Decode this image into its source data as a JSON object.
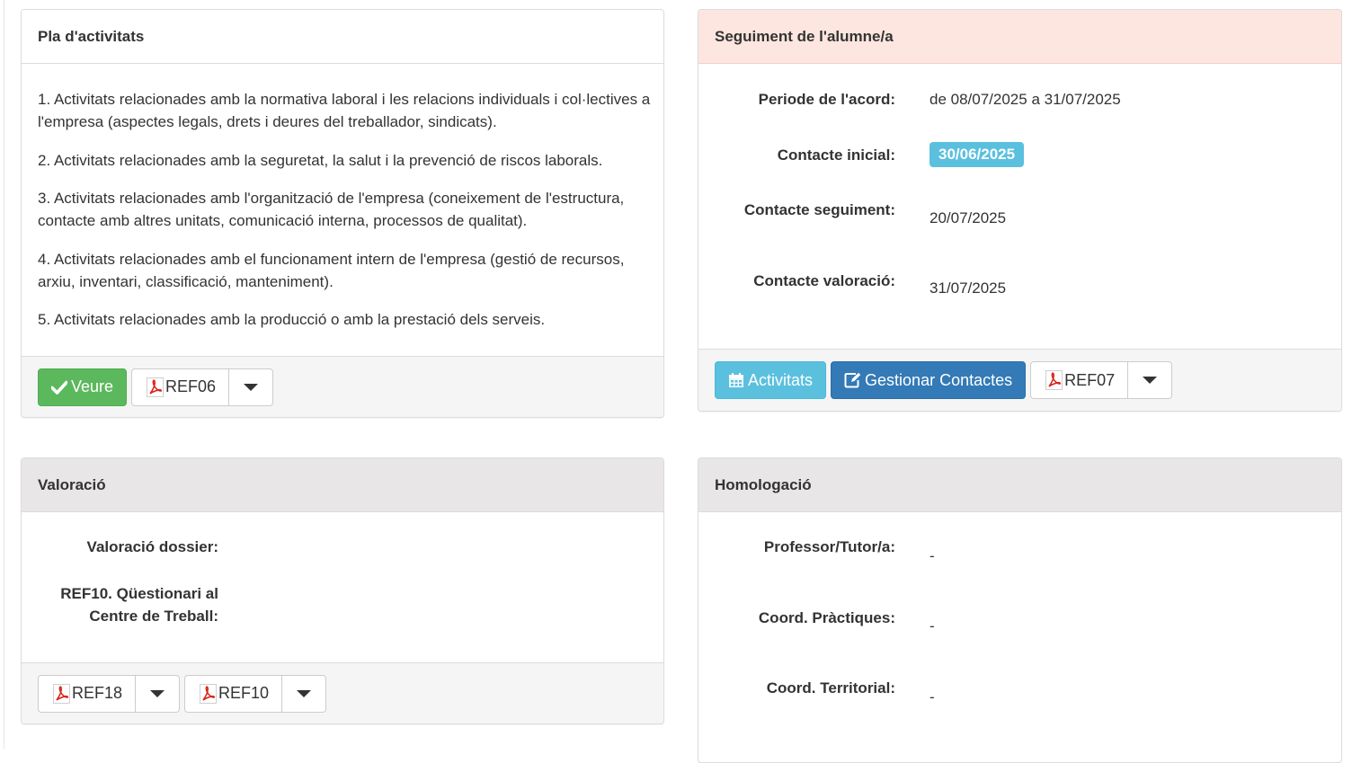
{
  "pla": {
    "title": "Pla d'activitats",
    "activities": [
      "1. Activitats relacionades amb la normativa laboral i les relacions individuals i col·lectives a l'empresa (aspectes legals, drets i deures del treballador, sindicats).",
      "2. Activitats relacionades amb la seguretat, la salut i la prevenció de riscos laborals.",
      "3. Activitats relacionades amb l'organització de l'empresa (coneixement de l'estructura, contacte amb altres unitats, comunicació interna, processos de qualitat).",
      "4. Activitats relacionades amb el funcionament intern de l'empresa (gestió de recursos, arxiu, inventari, classificació, manteniment).",
      "5. Activitats relacionades amb la producció o amb la prestació dels serveis."
    ],
    "veure_label": "Veure",
    "ref_label": "REF06"
  },
  "seguiment": {
    "title": "Seguiment de l'alumne/a",
    "periode_label": "Periode de l'acord:",
    "periode_value": "de 08/07/2025 a 31/07/2025",
    "inicial_label": "Contacte inicial:",
    "inicial_value": "30/06/2025",
    "seguiment_label": "Contacte seguiment:",
    "seguiment_value": "20/07/2025",
    "valoracio_label": "Contacte valoració:",
    "valoracio_value": "31/07/2025",
    "activitats_label": "Activitats",
    "gestionar_label": "Gestionar Contactes",
    "ref_label": "REF07"
  },
  "valoracio": {
    "title": "Valoració",
    "dossier_label": "Valoració dossier:",
    "q_label_1": "REF10. Qüestionari al",
    "q_label_2": "Centre de Treball:",
    "ref18_label": "REF18",
    "ref10_label": "REF10"
  },
  "homologacio": {
    "title": "Homologació",
    "professor_label": "Professor/Tutor/a:",
    "professor_value": "-",
    "coord_prac_label": "Coord. Pràctiques:",
    "coord_prac_value": "-",
    "coord_terr_label": "Coord. Territorial:",
    "coord_terr_value": "-"
  },
  "icons": {
    "check": "check-icon",
    "calendar": "calendar-icon",
    "edit": "edit-icon",
    "pdf": "pdf-icon",
    "caret": "caret-down-icon"
  },
  "colors": {
    "success": "#5cb85c",
    "info": "#5bc0de",
    "primary": "#337ab7",
    "danger_heading": "#fde6df",
    "gray_heading": "#e8e6e6",
    "pdf_red": "#d9261c"
  }
}
